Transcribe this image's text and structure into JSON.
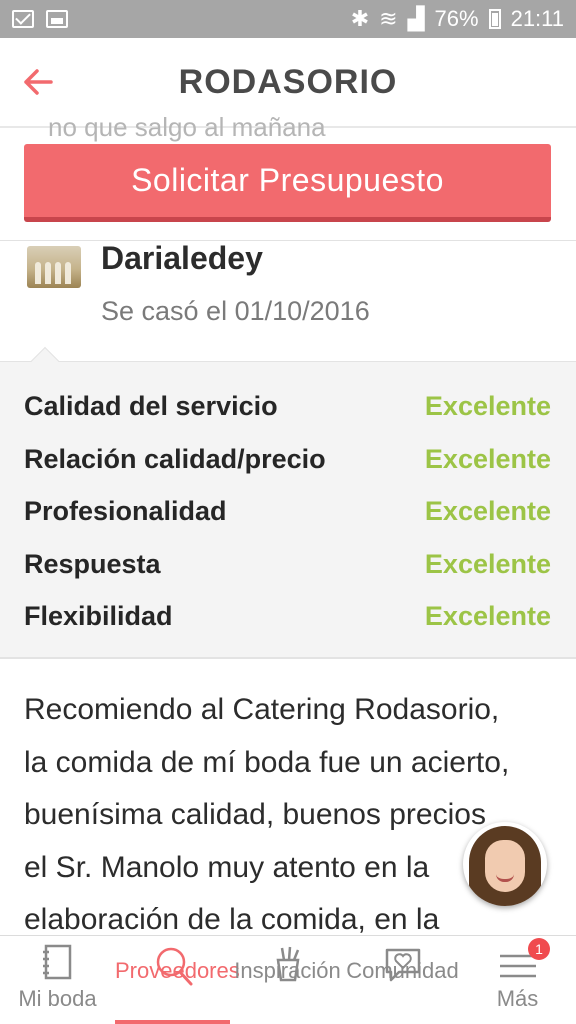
{
  "status_bar": {
    "battery": "76%",
    "time": "21:11"
  },
  "header": {
    "title": "RODASORIO"
  },
  "cutoff_text": "no que salgo al mañana",
  "cta": {
    "label": "Solicitar Presupuesto"
  },
  "review": {
    "author": "Darialedey",
    "married": "Se casó el 01/10/2016",
    "ratings": [
      {
        "label": "Calidad del servicio",
        "value": "Excelente"
      },
      {
        "label": "Relación calidad/precio",
        "value": "Excelente"
      },
      {
        "label": "Profesionalidad",
        "value": "Excelente"
      },
      {
        "label": "Respuesta",
        "value": "Excelente"
      },
      {
        "label": "Flexibilidad",
        "value": "Excelente"
      }
    ],
    "text_lines": [
      "Recomiendo al Catering Rodasorio,",
      "la comida de mí boda fue un acierto,",
      "buenísima calidad, buenos precios",
      "el Sr. Manolo muy atento en la",
      "elaboración de la comida, en la"
    ]
  },
  "bottom_nav": {
    "items": [
      {
        "label": "Mi boda",
        "icon": "notebook-icon"
      },
      {
        "label": "Proveedores",
        "icon": "search-icon"
      },
      {
        "label": "Inspiración",
        "icon": "pencil-cup-icon"
      },
      {
        "label": "Comunidad",
        "icon": "chat-heart-icon"
      },
      {
        "label": "Más",
        "icon": "menu-icon"
      }
    ],
    "badge": "1"
  },
  "colors": {
    "accent": "#f26a6e",
    "excellent": "#9cc446",
    "status_bar": "#a6a6a6"
  }
}
